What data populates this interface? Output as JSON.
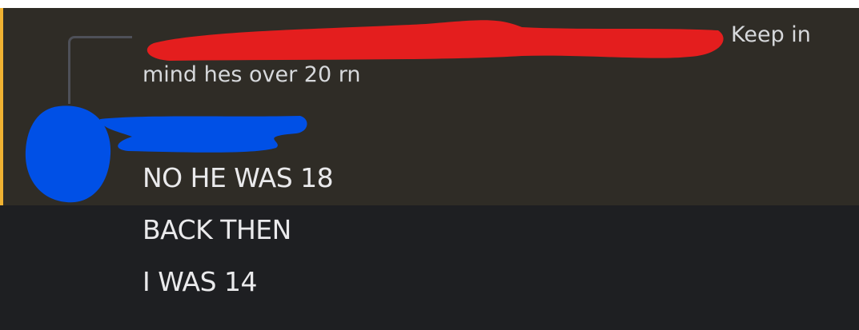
{
  "reply_preview": {
    "text_end": "Keep in",
    "text_continuation": "mind hes over 20 rn"
  },
  "message": {
    "lines": [
      "NO HE WAS 18",
      "BACK THEN",
      "I WAS 14"
    ]
  },
  "colors": {
    "background": "#1e1f22",
    "mention_highlight": "#2f2c26",
    "mention_bar": "#f0b232",
    "redaction_red": "#e41e1e",
    "redaction_blue": "#0050e6"
  }
}
